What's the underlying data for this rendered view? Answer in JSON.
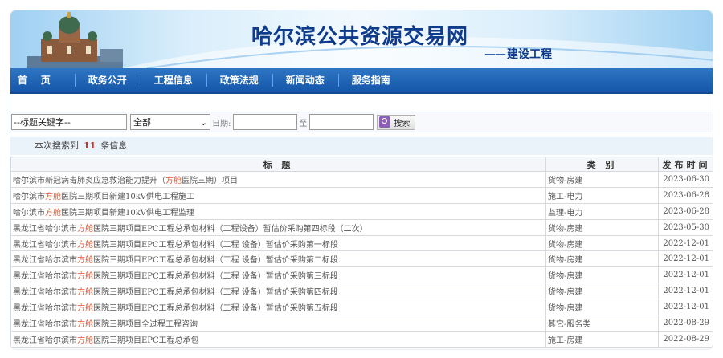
{
  "header": {
    "title": "哈尔滨公共资源交易网",
    "subtitle": "建设工程",
    "subtitle_dash": "——"
  },
  "nav": [
    "首    页",
    "政务公开",
    "工程信息",
    "政策法规",
    "新闻动态",
    "服务指南"
  ],
  "search": {
    "keyword_value": "--标题关键字--",
    "type_value": "全部",
    "date_label": "日期:",
    "to_label": "至",
    "button_label": "搜索"
  },
  "results": {
    "prefix": "本次搜索到",
    "count": "11",
    "suffix": "条信息"
  },
  "table": {
    "headers": [
      "标  题",
      "类  别",
      "发布时间"
    ],
    "rows": [
      {
        "pre": "哈尔滨市新冠病毒肺炎应急救治能力提升（",
        "hl": "方舱",
        "post": "医院三期）项目",
        "category": "货物-房建",
        "date": "2023-06-30"
      },
      {
        "pre": "哈尔滨市",
        "hl": "方舱",
        "post": "医院三期项目新建10kV供电工程施工",
        "category": "施工-电力",
        "date": "2023-06-28"
      },
      {
        "pre": "哈尔滨市",
        "hl": "方舱",
        "post": "医院三期项目新建10kV供电工程监理",
        "category": "监理-电力",
        "date": "2023-06-28"
      },
      {
        "pre": "黑龙江省哈尔滨市",
        "hl": "方舱",
        "post": "医院三期项目EPC工程总承包材料（工程设备）暂估价采购第四标段（二次）",
        "category": "货物-房建",
        "date": "2023-05-30"
      },
      {
        "pre": "黑龙江省哈尔滨市",
        "hl": "方舱",
        "post": "医院三期项目EPC工程总承包材料（工程 设备）暂估价采购第一标段",
        "category": "货物-房建",
        "date": "2022-12-01"
      },
      {
        "pre": "黑龙江省哈尔滨市",
        "hl": "方舱",
        "post": "医院三期项目EPC工程总承包材料（工程 设备）暂估价采购第二标段",
        "category": "货物-房建",
        "date": "2022-12-01"
      },
      {
        "pre": "黑龙江省哈尔滨市",
        "hl": "方舱",
        "post": "医院三期项目EPC工程总承包材料（工程 设备）暂估价采购第三标段",
        "category": "货物-房建",
        "date": "2022-12-01"
      },
      {
        "pre": "黑龙江省哈尔滨市",
        "hl": "方舱",
        "post": "医院三期项目EPC工程总承包材料（工程 设备）暂估价采购第四标段",
        "category": "货物-房建",
        "date": "2022-12-01"
      },
      {
        "pre": "黑龙江省哈尔滨市",
        "hl": "方舱",
        "post": "医院三期项目EPC工程总承包材料（工程 设备）暂估价采购第五标段",
        "category": "货物-房建",
        "date": "2022-12-01"
      },
      {
        "pre": "黑龙江省哈尔滨市",
        "hl": "方舱",
        "post": "医院三期项目全过程工程咨询",
        "category": "其它-服务类",
        "date": "2022-08-29"
      },
      {
        "pre": "黑龙江省哈尔滨市",
        "hl": "方舱",
        "post": "医院三期项目EPC工程总承包",
        "category": "施工-房建",
        "date": "2022-08-29"
      }
    ]
  },
  "colors": {
    "nav_bg": "#1d62b3",
    "title": "#0e3b8c",
    "highlight": "#e2552b",
    "count": "#d0302f"
  }
}
